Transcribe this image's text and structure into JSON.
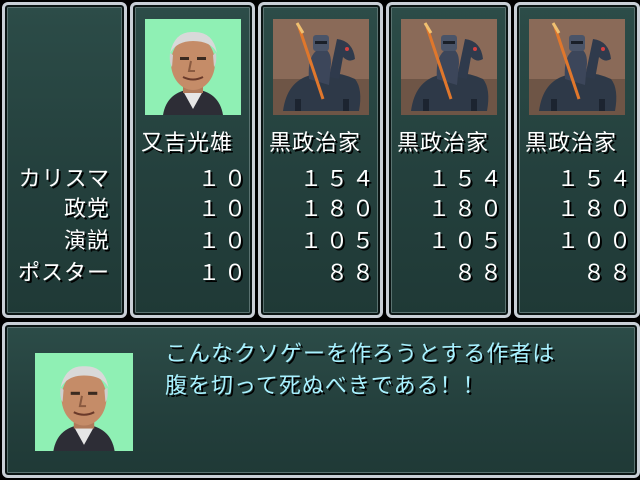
{
  "stat_labels": [
    "カリスマ",
    "政党",
    "演説",
    "ポスター"
  ],
  "candidates": [
    {
      "name": "又吉光雄",
      "portrait_icon": "politician-portrait",
      "stats": [
        "１０",
        "１０",
        "１０",
        "１０"
      ]
    },
    {
      "name": "黒政治家",
      "portrait_icon": "black-knight-portrait",
      "stats": [
        "１５４",
        "１８０",
        "１０５",
        "８８"
      ]
    },
    {
      "name": "黒政治家",
      "portrait_icon": "black-knight-portrait",
      "stats": [
        "１５４",
        "１８０",
        "１０５",
        "８８"
      ]
    },
    {
      "name": "黒政治家",
      "portrait_icon": "black-knight-portrait",
      "stats": [
        "１５４",
        "１８０",
        "１００",
        "８８"
      ]
    }
  ],
  "dialogue": {
    "speaker_icon": "politician-portrait",
    "line1": "こんなクソゲーを作ろうとする作者は",
    "line2": "腹を切って死ぬべきである！！"
  },
  "colors": {
    "panel": "#2c4c48",
    "border": "#c9cfd6",
    "dialogue_text": "#a9f1ff",
    "stat_text": "#ffffff",
    "portrait_bg": "#8ff0b4"
  }
}
